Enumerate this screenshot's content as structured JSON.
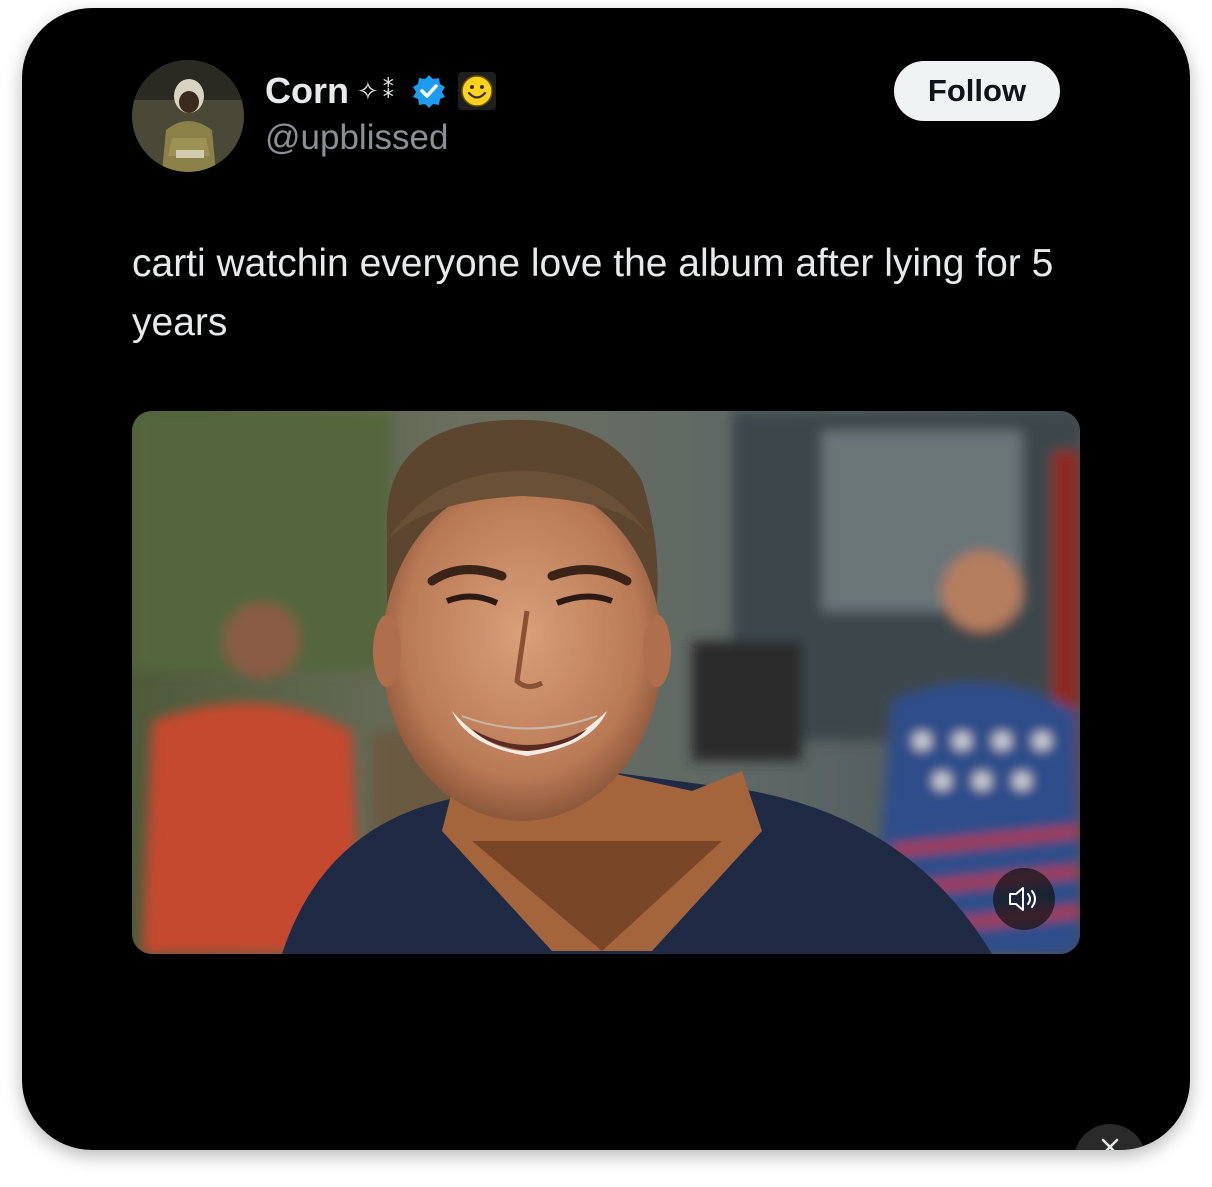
{
  "post": {
    "display_name": "Corn",
    "name_decor_1": "✧",
    "name_decor_2": "⁑",
    "handle": "@upblissed",
    "follow_label": "Follow",
    "text": "carti watchin everyone love the album after lying for 5 years",
    "media_icon": "speaker-mute-icon",
    "colors": {
      "background": "#000000",
      "text": "#e7e9ea",
      "secondary_text": "#8b9096",
      "verified": "#1d9bf0",
      "follow_bg": "#eff3f4"
    }
  }
}
